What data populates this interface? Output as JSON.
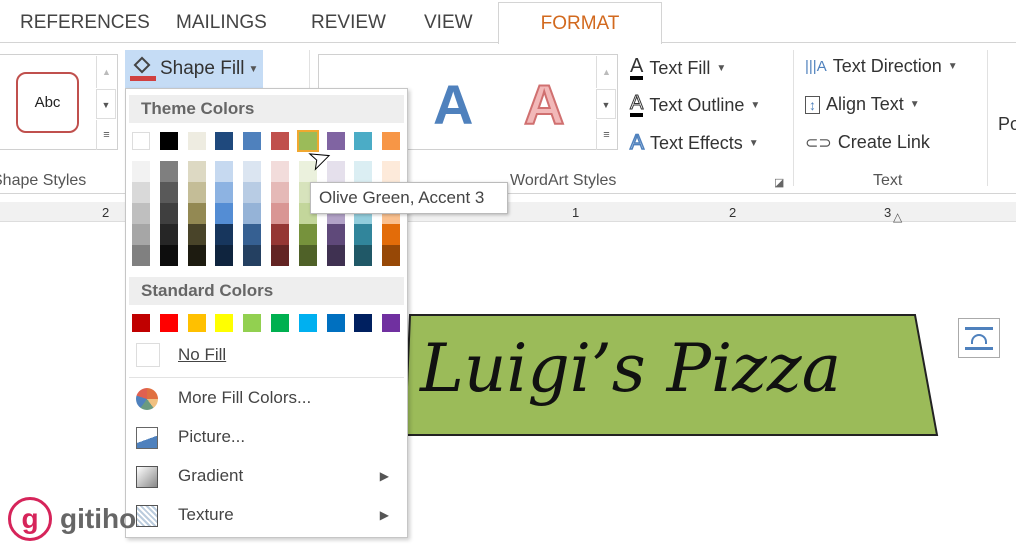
{
  "tabs": [
    "REFERENCES",
    "MAILINGS",
    "REVIEW",
    "VIEW",
    "FORMAT"
  ],
  "active_tab": "FORMAT",
  "ribbon": {
    "shape_styles": {
      "preview": "Abc",
      "label": "Shape Styles"
    },
    "shape_fill": "Shape Fill",
    "wordart": {
      "label": "WordArt Styles",
      "letter": "A"
    },
    "text_fill": "Text Fill",
    "text_outline": "Text Outline",
    "text_effects": "Text Effects",
    "text_direction": "Text Direction",
    "align_text": "Align Text",
    "create_link": "Create Link",
    "text_group": "Text",
    "position_partial": "Po"
  },
  "ruler": {
    "numbers": [
      "2",
      "1",
      "2",
      "3"
    ]
  },
  "menu": {
    "theme_header": "Theme Colors",
    "theme_colors": [
      "#ffffff",
      "#000000",
      "#eeece1",
      "#1f497d",
      "#4f81bd",
      "#c0504d",
      "#9bbb59",
      "#8064a2",
      "#4bacc6",
      "#f79646"
    ],
    "theme_shades": [
      [
        "#f2f2f2",
        "#d9d9d9",
        "#bfbfbf",
        "#a6a6a6",
        "#808080"
      ],
      [
        "#7f7f7f",
        "#595959",
        "#3f3f3f",
        "#262626",
        "#0d0d0d"
      ],
      [
        "#ddd9c3",
        "#c4bd97",
        "#938953",
        "#494429",
        "#1d1b10"
      ],
      [
        "#c6d9f0",
        "#8db3e2",
        "#548dd4",
        "#17365d",
        "#0f243e"
      ],
      [
        "#dbe5f1",
        "#b8cce4",
        "#95b3d7",
        "#366092",
        "#244061"
      ],
      [
        "#f2dcdb",
        "#e5b9b7",
        "#d99694",
        "#953734",
        "#632423"
      ],
      [
        "#ebf1dd",
        "#d7e3bc",
        "#c3d69b",
        "#76923c",
        "#4f6128"
      ],
      [
        "#e5e0ec",
        "#ccc1d9",
        "#b2a2c7",
        "#5f497a",
        "#3f3151"
      ],
      [
        "#dbeef3",
        "#b7dde8",
        "#92cddc",
        "#31859b",
        "#205867"
      ],
      [
        "#fdeada",
        "#fbd5b5",
        "#fac08f",
        "#e36c09",
        "#974806"
      ]
    ],
    "selected_index": 6,
    "standard_header": "Standard Colors",
    "standard_colors": [
      "#c00000",
      "#ff0000",
      "#ffc000",
      "#ffff00",
      "#92d050",
      "#00b050",
      "#00b0f0",
      "#0070c0",
      "#002060",
      "#7030a0"
    ],
    "no_fill": "No Fill",
    "more_fill": "More Fill Colors...",
    "picture": "Picture...",
    "gradient": "Gradient",
    "texture": "Texture"
  },
  "tooltip": "Olive Green, Accent 3",
  "document": {
    "shape_text": "Luigi’s Pizza",
    "shape_fill": "#9bbb59"
  },
  "watermark": "gitiho"
}
